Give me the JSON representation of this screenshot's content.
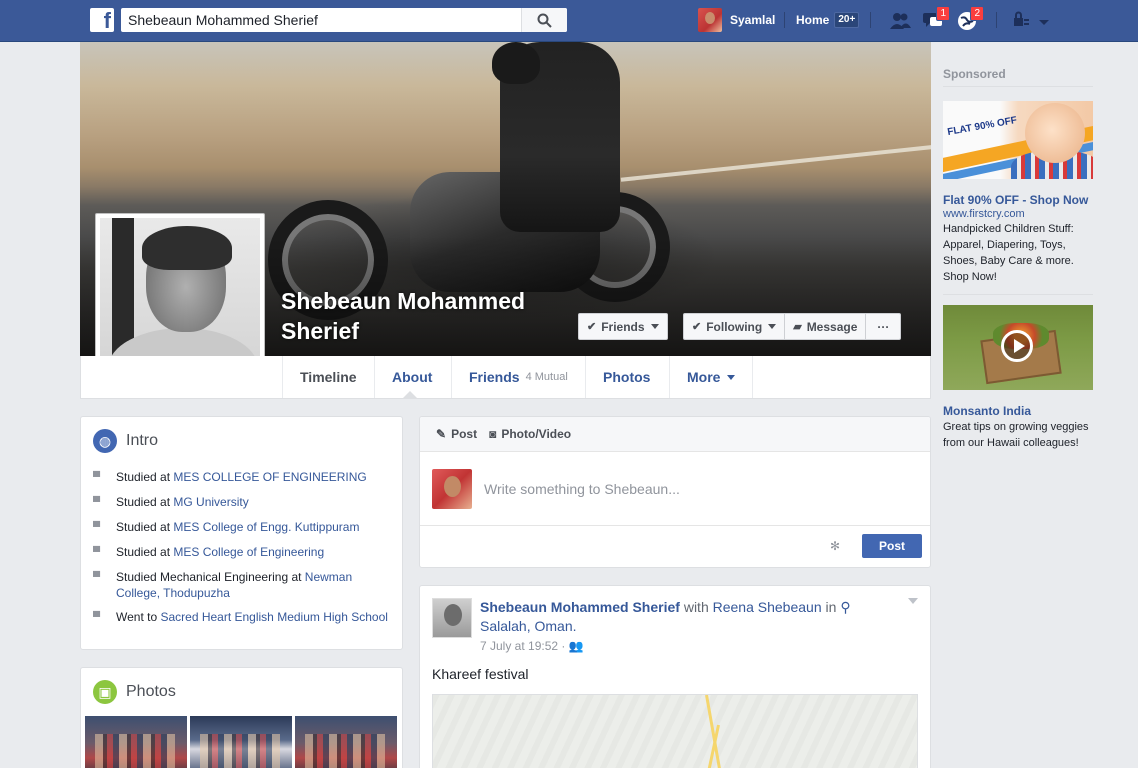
{
  "topbar": {
    "search_value": "Shebeaun Mohammed Sherief",
    "user_name": "Syamlal",
    "home_label": "Home",
    "home_count": "20+",
    "messages_badge": "1",
    "notifications_badge": "2",
    "brand_color": "#3b5998"
  },
  "profile": {
    "name": "Shebeaun Mohammed Sherief",
    "buttons": {
      "friends": "Friends",
      "following": "Following",
      "message": "Message",
      "more": "···"
    }
  },
  "tabs": [
    {
      "label": "Timeline"
    },
    {
      "label": "About"
    },
    {
      "label": "Friends",
      "sub": "4 Mutual"
    },
    {
      "label": "Photos"
    },
    {
      "label": "More"
    }
  ],
  "intro": {
    "title": "Intro",
    "items": [
      {
        "prefix": "Studied at ",
        "link": "MES COLLEGE OF ENGINEERING"
      },
      {
        "prefix": "Studied at ",
        "link": "MG University"
      },
      {
        "prefix": "Studied at ",
        "link": "MES College of Engg. Kuttippuram"
      },
      {
        "prefix": "Studied at ",
        "link": "MES College of Engineering"
      },
      {
        "prefix": "Studied Mechanical Engineering at ",
        "link": "Newman College, Thodupuzha"
      },
      {
        "prefix": "Went to ",
        "link": "Sacred Heart English Medium High School"
      }
    ]
  },
  "photos_card": {
    "title": "Photos"
  },
  "composer": {
    "tab_post": "Post",
    "tab_photo": "Photo/Video",
    "placeholder": "Write something to Shebeaun...",
    "post_button": "Post"
  },
  "feed_post": {
    "author": "Shebeaun Mohammed Sherief",
    "with_text": " with ",
    "with_name": "Reena Shebeaun",
    "in_text": " in ",
    "location": "Salalah, Oman.",
    "time": "7 July at 19:52 · ",
    "text": "Khareef festival"
  },
  "sidebar": {
    "sponsored": "Sponsored",
    "ad1": {
      "image_text": "FLAT 90% OFF",
      "title": "Flat 90% OFF - Shop Now",
      "url": "www.firstcry.com",
      "desc": "Handpicked Children Stuff: Apparel, Diapering, Toys, Shoes, Baby Care & more. Shop Now!"
    },
    "ad2": {
      "title": "Monsanto India",
      "desc": "Great tips on growing veggies from our Hawaii colleagues!"
    }
  }
}
